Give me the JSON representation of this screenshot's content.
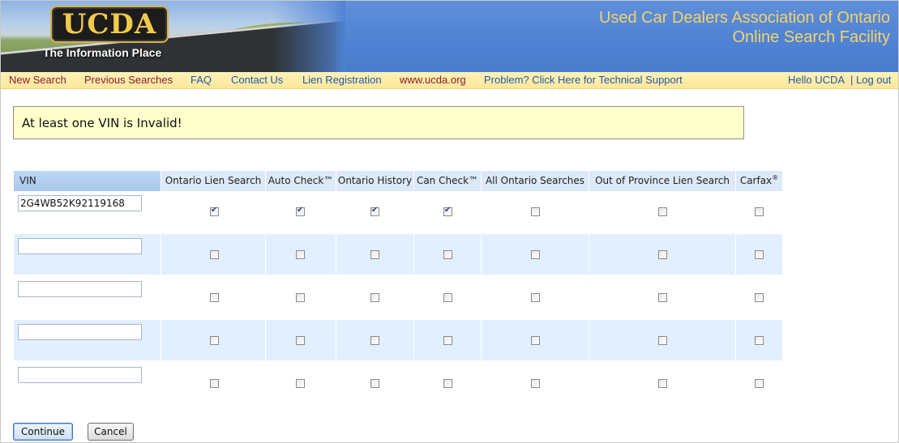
{
  "header": {
    "logo_text": "UCDA",
    "tagline": "The Information Place",
    "title_line1": "Used Car Dealers Association of Ontario",
    "title_line2": "Online Search Facility"
  },
  "nav": {
    "new_search": "New Search",
    "previous_searches": "Previous Searches",
    "faq": "FAQ",
    "contact_us": "Contact Us",
    "lien_registration": "Lien Registration",
    "website": "www.ucda.org",
    "support": "Problem? Click Here for Technical Support",
    "greeting": "Hello UCDA",
    "separator": "|",
    "logout": "Log out"
  },
  "error": {
    "message": "At least one VIN is Invalid!"
  },
  "grid": {
    "columns": {
      "vin": "VIN",
      "ontario_lien": "Ontario Lien Search",
      "auto_check": "Auto Check™",
      "ontario_history": "Ontario History",
      "can_check": "Can Check™",
      "all_ontario": "All Ontario Searches",
      "out_of_province": "Out of Province Lien Search",
      "carfax": "Carfax",
      "carfax_mark": "®"
    },
    "rows": [
      {
        "vin": "2G4WB52K92119168",
        "ontario_lien": true,
        "auto_check": true,
        "ontario_history": true,
        "can_check": true,
        "all_ontario": false,
        "out_of_province": false,
        "carfax": false
      },
      {
        "vin": "",
        "ontario_lien": false,
        "auto_check": false,
        "ontario_history": false,
        "can_check": false,
        "all_ontario": false,
        "out_of_province": false,
        "carfax": false
      },
      {
        "vin": "",
        "ontario_lien": false,
        "auto_check": false,
        "ontario_history": false,
        "can_check": false,
        "all_ontario": false,
        "out_of_province": false,
        "carfax": false
      },
      {
        "vin": "",
        "ontario_lien": false,
        "auto_check": false,
        "ontario_history": false,
        "can_check": false,
        "all_ontario": false,
        "out_of_province": false,
        "carfax": false
      },
      {
        "vin": "",
        "ontario_lien": false,
        "auto_check": false,
        "ontario_history": false,
        "can_check": false,
        "all_ontario": false,
        "out_of_province": false,
        "carfax": false
      }
    ]
  },
  "actions": {
    "continue": "Continue",
    "cancel": "Cancel"
  },
  "colors": {
    "header_blue": "#4f82d4",
    "title_gold": "#f3d36a",
    "nav_maroon": "#8b1a2b",
    "nav_blue": "#1f57a8",
    "error_bg": "#ffffcc",
    "row_alt": "#e1efff"
  }
}
